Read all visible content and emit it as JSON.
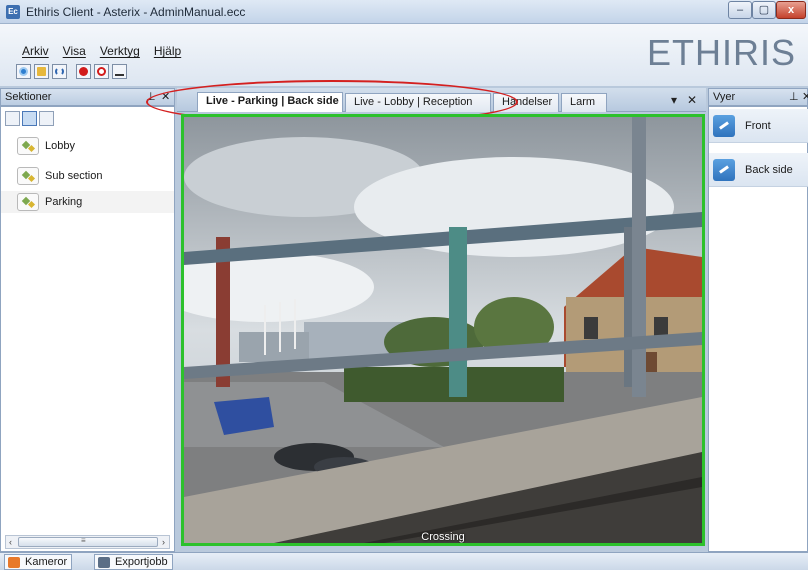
{
  "window": {
    "title": "Ethiris Client - Asterix - AdminManual.ecc",
    "app_icon_text": "Ec",
    "minimize": "–",
    "maximize": "▢",
    "close": "x"
  },
  "menu": [
    "Arkiv",
    "Visa",
    "Verktyg",
    "Hjälp"
  ],
  "toolbar_icons": [
    "settings-icon",
    "folder-icon",
    "brackets-icon",
    "record-icon",
    "power-icon",
    "anchor-icon"
  ],
  "logo": "ETHIRIS",
  "left_panel": {
    "title": "Sektioner",
    "pin": "⊥",
    "close": "✕",
    "sections": [
      "Lobby",
      "Sub section",
      "Parking"
    ],
    "selected": "Parking",
    "scroll_left": "‹",
    "scroll_grip": "≡",
    "scroll_right": "›"
  },
  "tabs": [
    {
      "label": "Live - Parking | Back side",
      "active": true
    },
    {
      "label": "Live - Lobby | Reception",
      "active": false
    },
    {
      "label": "Händelser",
      "active": false
    },
    {
      "label": "Larm",
      "active": false
    }
  ],
  "tab_controls": {
    "dropdown": "▾",
    "close": "✕"
  },
  "video": {
    "camera_label": "Crossing",
    "border_color": "#2cc12c"
  },
  "right_panel": {
    "title": "Vyer",
    "pin": "⊥",
    "close": "✕",
    "views": [
      "Front",
      "Back side"
    ]
  },
  "statusbar": {
    "tabs": [
      "Kameror",
      "Exportjobb"
    ]
  },
  "colors": {
    "accent": "#3d6fb0",
    "highlight": "#d42020"
  }
}
